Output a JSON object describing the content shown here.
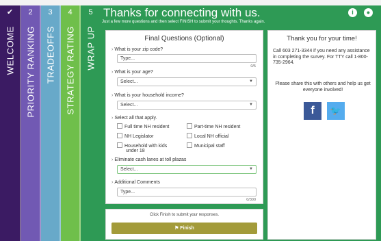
{
  "tabs": [
    {
      "num": "✔",
      "label": "WELCOME"
    },
    {
      "num": "2",
      "label": "PRIORITY RANKING"
    },
    {
      "num": "3",
      "label": "TRADEOFFS"
    },
    {
      "num": "4",
      "label": "STRATEGY RATING"
    },
    {
      "num": "5",
      "label": "WRAP UP"
    }
  ],
  "header": {
    "title": "Thanks for connecting with us.",
    "subtitle": "Just a few more questions and then select FINISH to submit your thoughts. Thanks again."
  },
  "questions": {
    "title": "Final Questions (Optional)",
    "zip_label": "What is your zip code?",
    "zip_placeholder": "Type...",
    "zip_counter": "0/5",
    "age_label": "What is your age?",
    "age_value": "Select...",
    "income_label": "What is your household income?",
    "income_value": "Select...",
    "select_all_label": "Select all that apply.",
    "options": [
      "Full time NH resident",
      "Part-time NH resident",
      "NH Legislator",
      "Local NH official",
      "Household with kids",
      "under 18",
      "Municipal staff"
    ],
    "cash_label": "Eliminate cash lanes at toll plazas",
    "cash_value": "Select...",
    "comments_label": "Additional Comments",
    "comments_placeholder": "Type...",
    "comments_counter": "0/300"
  },
  "finish": {
    "note": "Click Finish to submit your responses.",
    "button_label": "Finish"
  },
  "thanks": {
    "title": "Thank you for your time!",
    "body": "Call 603 271-3344 if you need any assistance in completing the survey. For TTY call 1-800-735-2964.",
    "share": "Please share this with others and help us get everyone involved!"
  },
  "colors": {
    "tab1": "#3b1b63",
    "tab2": "#7159b3",
    "tab3": "#68a9c9",
    "tab4": "#6fbf4b",
    "tab5": "#2e9a55",
    "finish": "#a39b3a",
    "facebook": "#3b5998",
    "twitter": "#55acee"
  },
  "icons": [
    "info-icon",
    "chat-icon",
    "check-icon",
    "flag-icon",
    "facebook-icon",
    "twitter-icon"
  ]
}
